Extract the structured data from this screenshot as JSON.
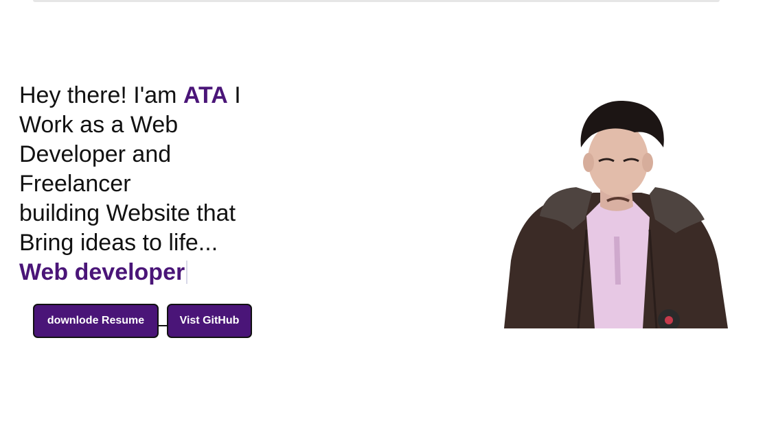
{
  "hero": {
    "greeting": "Hey there! I'am ",
    "name": "ATA",
    "line1_tail": " I",
    "line2": "Work as a Web",
    "line3": "Developer and",
    "line4": "Freelancer",
    "line5": "building Website that",
    "line6": "Bring ideas to life...",
    "typed_role": "Web developer"
  },
  "buttons": {
    "resume_label": "downlode Resume",
    "github_label": "Vist GitHub"
  },
  "colors": {
    "accent": "#4a1578",
    "background": "#ffffff",
    "text": "#111111"
  },
  "image": {
    "alt": "profile-photo"
  }
}
